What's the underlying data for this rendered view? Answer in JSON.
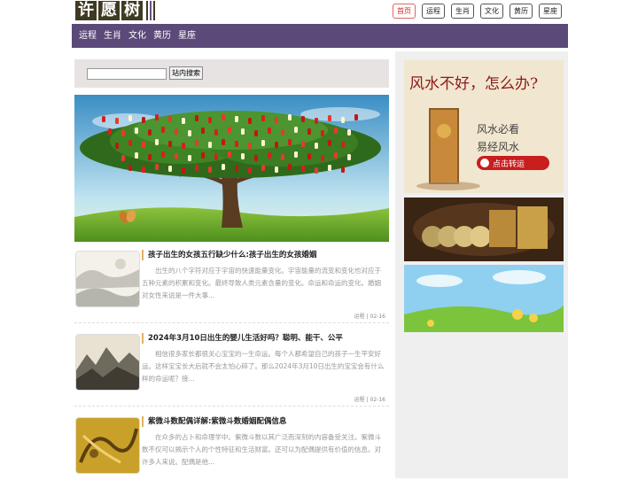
{
  "logo": {
    "chars": [
      "许",
      "愿",
      "树"
    ]
  },
  "top_nav": [
    {
      "label": "首页",
      "active": true
    },
    {
      "label": "运程",
      "active": false
    },
    {
      "label": "生肖",
      "active": false
    },
    {
      "label": "文化",
      "active": false
    },
    {
      "label": "黄历",
      "active": false
    },
    {
      "label": "星座",
      "active": false
    }
  ],
  "main_nav": [
    "运程",
    "生肖",
    "文化",
    "黄历",
    "星座"
  ],
  "search": {
    "value": "",
    "button": "站内搜索"
  },
  "articles": [
    {
      "title": "孩子出生的女孩五行缺少什么:孩子出生的女孩婚姻",
      "desc": "出生的八个字符对应于宇宙的快速能量变化。宇宙能量的流变和变化也对应于五种元素的积累和变化。最终导致人类元素含量的变化。命运和命运的变化。婚姻对女性来说是一件大事...",
      "category": "运程",
      "date": "02-16",
      "thumb": "landscape-painting"
    },
    {
      "title": "2024年3月10日出生的婴儿生活好吗？聪明、能干、公平",
      "desc": "相信很多家长都很关心宝宝的一生命运。每个人都希望自己的孩子一生平安好运。这样宝宝长大后就不会太怕心碎了。那么2024年3月10日出生的宝宝会有什么样的命运呢？接...",
      "category": "运程",
      "date": "02-16",
      "thumb": "ink-mountain"
    },
    {
      "title": "紫微斗数配偶详解:紫微斗数婚姻配偶信息",
      "desc": "在众多的占卜和命理学中。紫微斗数以其广泛而深刻的内容备受关注。紫微斗数不仅可以揭示个人的个性特征和生活财富。还可以为配偶提供有价值的信息。对许多人来说。配偶是他...",
      "category": "",
      "date": "",
      "thumb": "gold-dragon"
    }
  ],
  "ads": {
    "ad1": {
      "headline": "风水不好，怎么办?",
      "sub1": "风水必看",
      "sub2": "易经风水",
      "button": "点击转运"
    }
  },
  "colors": {
    "nav_bg": "#5b4979",
    "logo_bg": "#3f3a22",
    "accent": "#d22222",
    "sidebar_bg": "#efefef"
  }
}
